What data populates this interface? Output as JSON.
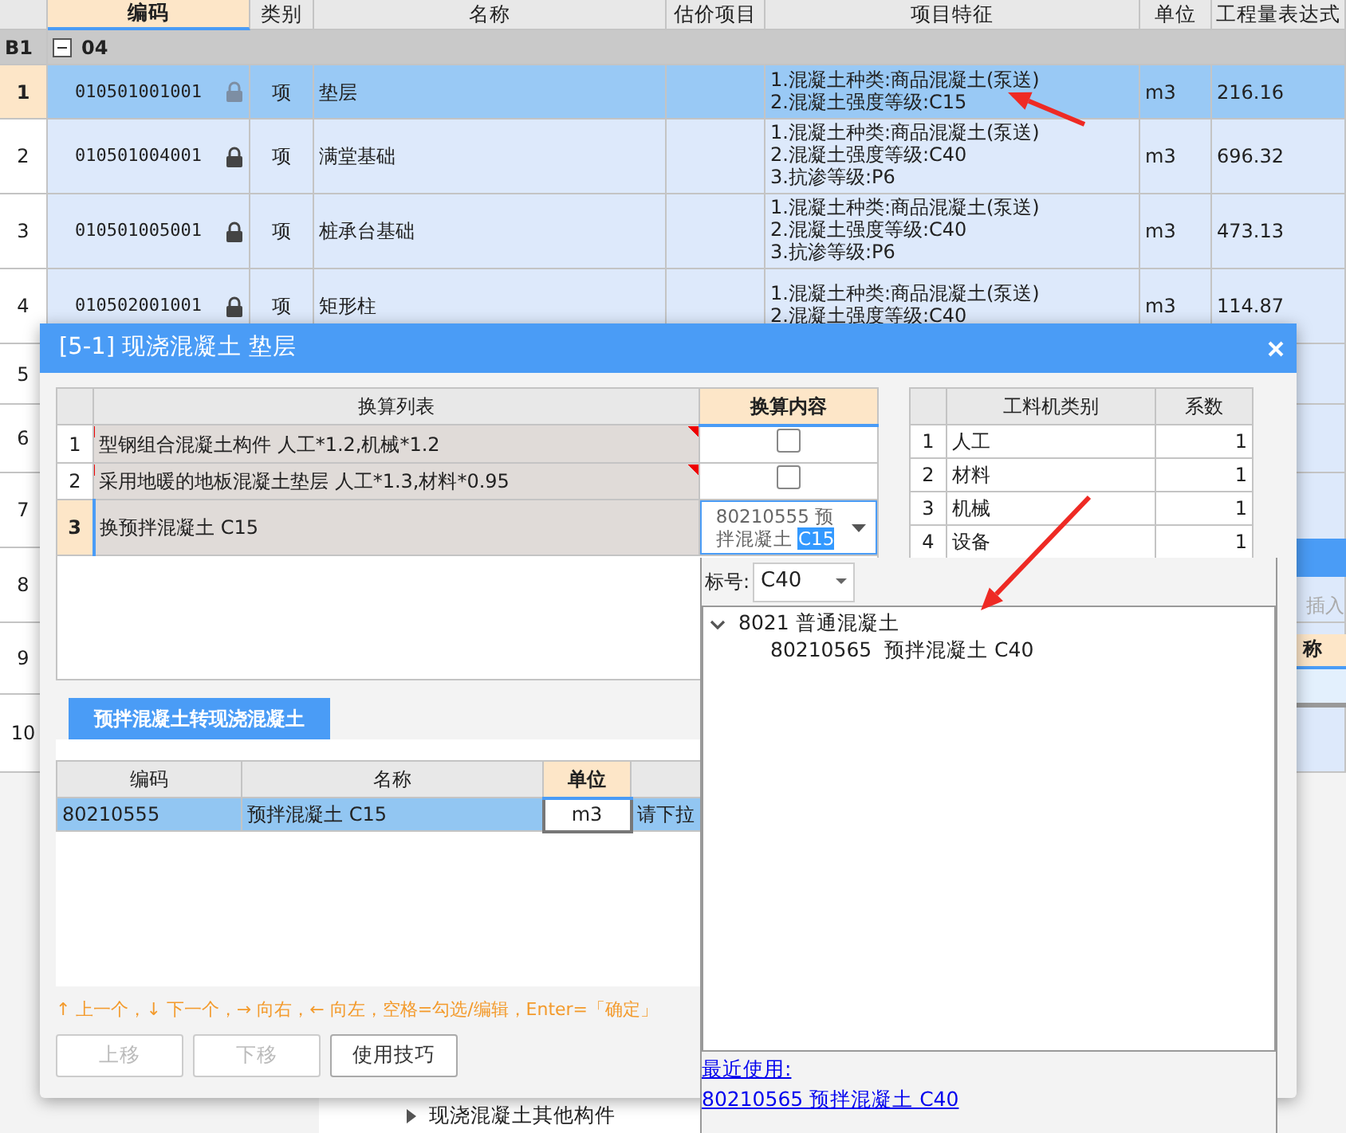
{
  "grid": {
    "columns": [
      "编码",
      "类别",
      "名称",
      "估价项目",
      "项目特征",
      "单位",
      "工程量表达式"
    ],
    "group": {
      "row_label": "B1",
      "expanded": true,
      "code": "04"
    },
    "rows": [
      {
        "num": "1",
        "selected": true,
        "code": "010501001001",
        "locked": true,
        "type": "项",
        "name": "垫层",
        "features": [
          "1.混凝土种类:商品混凝土(泵送)",
          "2.混凝土强度等级:C15"
        ],
        "unit": "m3",
        "quantity": "216.16"
      },
      {
        "num": "2",
        "selected": false,
        "code": "010501004001",
        "locked": true,
        "type": "项",
        "name": "满堂基础",
        "features": [
          "1.混凝土种类:商品混凝土(泵送)",
          "2.混凝土强度等级:C40",
          "3.抗渗等级:P6"
        ],
        "unit": "m3",
        "quantity": "696.32"
      },
      {
        "num": "3",
        "selected": false,
        "code": "010501005001",
        "locked": true,
        "type": "项",
        "name": "桩承台基础",
        "features": [
          "1.混凝土种类:商品混凝土(泵送)",
          "2.混凝土强度等级:C40",
          "3.抗渗等级:P6"
        ],
        "unit": "m3",
        "quantity": "473.13"
      },
      {
        "num": "4",
        "selected": false,
        "code": "010502001001",
        "locked": true,
        "type": "项",
        "name": "矩形柱",
        "features": [
          "1.混凝土种类:商品混凝土(泵送)",
          "2.混凝土强度等级:C40"
        ],
        "unit": "m3",
        "quantity": "114.87"
      }
    ],
    "covered_row_numbers": [
      "5",
      "6",
      "7",
      "8",
      "9",
      "10"
    ]
  },
  "dialog": {
    "title": "[5-1] 现浇混凝土 垫层",
    "conversion_table": {
      "columns": [
        "换算列表",
        "换算内容"
      ],
      "rows": [
        {
          "num": "1",
          "label": "型钢组合混凝土构件 人工*1.2,机械*1.2",
          "kind": "checkbox",
          "checked": false,
          "selected": false
        },
        {
          "num": "2",
          "label": "采用地暖的地板混凝土垫层 人工*1.3,材料*0.95",
          "kind": "checkbox",
          "checked": false,
          "selected": false
        },
        {
          "num": "3",
          "label": "换预拌混凝土 C15",
          "kind": "dropdown",
          "value": "80210555  预拌混凝土",
          "highlighted": "C15",
          "selected": true
        }
      ]
    },
    "factor_table": {
      "columns": [
        "工料机类别",
        "系数"
      ],
      "rows": [
        {
          "num": "1",
          "category": "人工",
          "factor": "1"
        },
        {
          "num": "2",
          "category": "材料",
          "factor": "1"
        },
        {
          "num": "3",
          "category": "机械",
          "factor": "1"
        },
        {
          "num": "4",
          "category": "设备",
          "factor": "1"
        }
      ]
    },
    "tabs": [
      {
        "label": "预拌混凝土转现浇混凝土",
        "selected": true
      }
    ],
    "material_table": {
      "columns": [
        "编码",
        "名称",
        "单位"
      ],
      "rows": [
        {
          "code": "80210555",
          "name": "预拌混凝土 C15",
          "unit": "m3",
          "column_4": "请下拉",
          "selected": true
        }
      ]
    },
    "hint": "↑ 上一个，↓ 下一个，→ 向右，← 向左，空格=勾选/编辑，Enter=「确定」",
    "buttons": [
      {
        "label": "上移",
        "disabled": true
      },
      {
        "label": "下移",
        "disabled": true
      },
      {
        "label": "使用技巧",
        "disabled": false
      }
    ]
  },
  "picker": {
    "grade_label": "标号:",
    "grade": "C40",
    "tree": [
      {
        "label": "8021 普通混凝土",
        "expanded": true,
        "children": [
          {
            "label": "80210565  预拌混凝土 C40"
          }
        ]
      }
    ],
    "recent_label": "最近使用:",
    "recent": [
      "80210565 预拌混凝土 C40"
    ]
  },
  "background_panel": {
    "insert_label": "插入",
    "column_header": "称",
    "tree_item": "现浇混凝土其他构件"
  }
}
